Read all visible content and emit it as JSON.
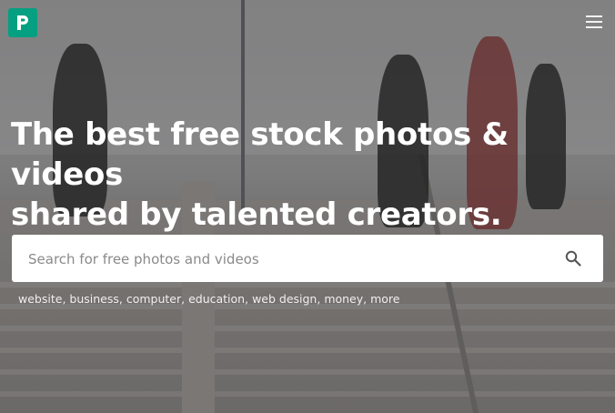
{
  "brand": {
    "logo_icon": "pexels-logo-icon",
    "accent": "#05a081"
  },
  "header": {
    "menu_icon": "hamburger-menu-icon"
  },
  "hero": {
    "headline_line1": "The best free stock photos & videos",
    "headline_line2": "shared by talented creators."
  },
  "search": {
    "placeholder": "Search for free photos and videos",
    "value": "",
    "icon": "search-icon"
  },
  "tags": [
    "website",
    "business",
    "computer",
    "education",
    "web design",
    "money",
    "more"
  ]
}
